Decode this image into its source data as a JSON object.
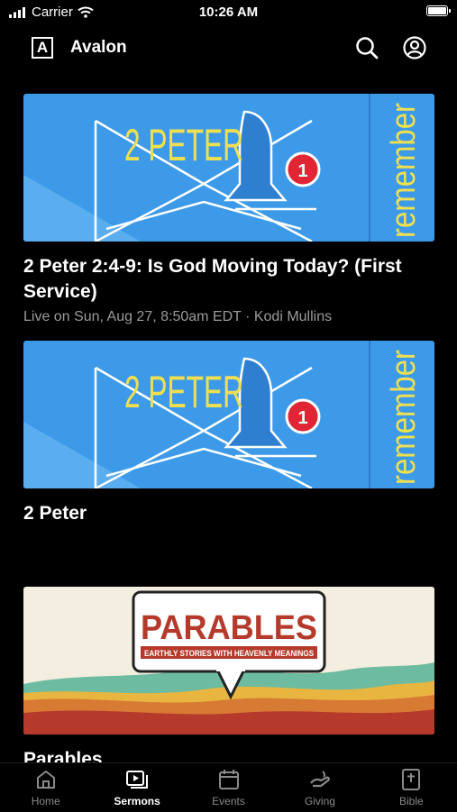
{
  "status_bar": {
    "carrier": "Carrier",
    "time": "10:26 AM"
  },
  "header": {
    "logo_letter": "A",
    "title": "Avalon"
  },
  "feed": [
    {
      "thumb_title": "2 PETER",
      "thumb_side_text": "remember",
      "badge_count": "1",
      "title": "2 Peter 2:4-9: Is God Moving Today? (First Service)",
      "meta": "Live on Sun, Aug 27, 8:50am EDT · Kodi Mullins"
    },
    {
      "thumb_title": "2 PETER",
      "thumb_side_text": "remember",
      "badge_count": "1",
      "title": "2 Peter"
    },
    {
      "thumb_title": "PARABLES",
      "thumb_subtitle": "EARTHLY STORIES WITH HEAVENLY MEANINGS",
      "title": "Parables"
    }
  ],
  "tabs": [
    {
      "label": "Home",
      "icon": "home-icon"
    },
    {
      "label": "Sermons",
      "icon": "sermons-icon",
      "active": true
    },
    {
      "label": "Events",
      "icon": "calendar-icon"
    },
    {
      "label": "Giving",
      "icon": "giving-icon"
    },
    {
      "label": "Bible",
      "icon": "bible-icon"
    }
  ],
  "colors": {
    "background": "#000000",
    "peter_blue": "#3d9ae8",
    "peter_yellow": "#f0e050",
    "badge_red": "#e02535",
    "parables_red": "#b53a2c"
  }
}
